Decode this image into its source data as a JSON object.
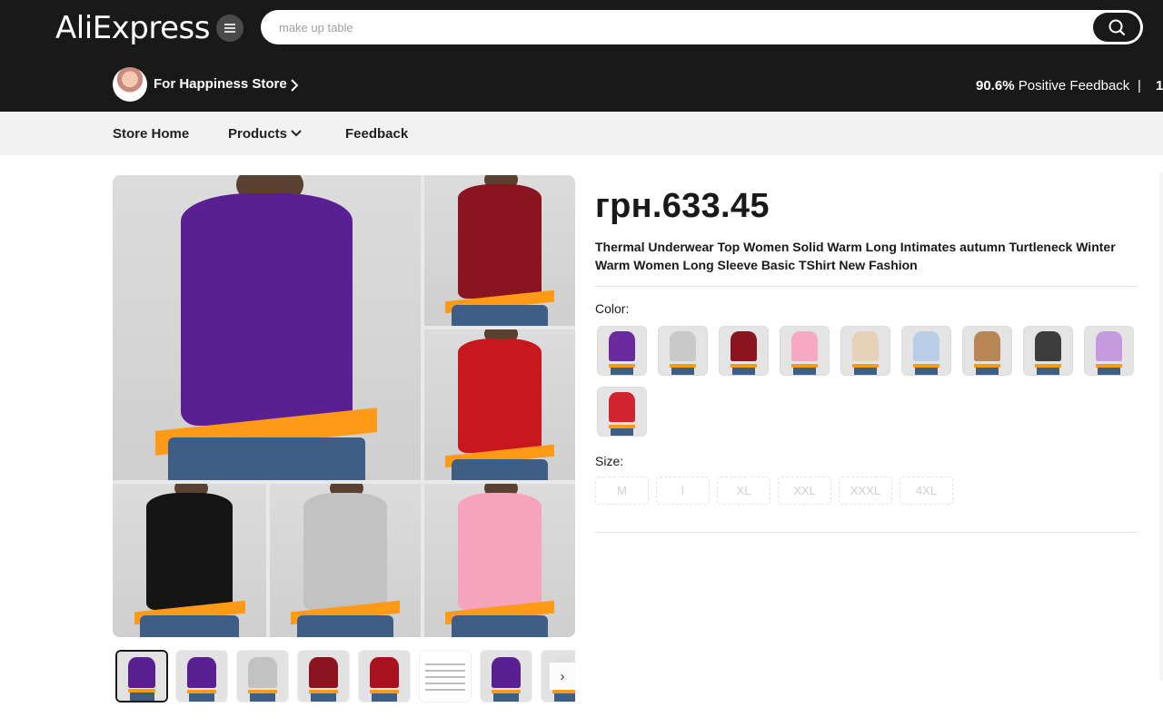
{
  "header": {
    "logo": "AliExpress",
    "search": {
      "value": "",
      "placeholder": "make up table"
    }
  },
  "store": {
    "name": "For Happiness Store",
    "feedback_percent": "90.6%",
    "feedback_label": "Positive Feedback",
    "separator": "|",
    "followers_partial": "1"
  },
  "nav": {
    "items": [
      {
        "label": "Store Home"
      },
      {
        "label": "Products"
      },
      {
        "label": "Feedback"
      }
    ]
  },
  "gallery": {
    "tiles": [
      {
        "color": "#5b1f94"
      },
      {
        "color": "#8a1420"
      },
      {
        "color": "#c8171f"
      },
      {
        "color": "#151515"
      },
      {
        "color": "#c2c2c2"
      },
      {
        "color": "#f6a3bd"
      }
    ],
    "thumbnails": [
      {
        "color": "#5b1f94",
        "active": true
      },
      {
        "color": "#5b1f94"
      },
      {
        "color": "#c2c2c2"
      },
      {
        "color": "#8a1420"
      },
      {
        "color": "#a8121e"
      },
      {
        "color": "size-chart"
      },
      {
        "color": "#5b1f94"
      },
      {
        "color": "#dedede"
      }
    ],
    "next_icon": "›"
  },
  "product": {
    "price": "грн.633.45",
    "title": "Thermal Underwear Top Women Solid Warm Long Intimates autumn Turtleneck Winter Warm Women Long Sleeve Basic TShirt New Fashion",
    "color_label": "Color:",
    "colors": [
      {
        "color": "#6a2aa0"
      },
      {
        "color": "#c9c9c9"
      },
      {
        "color": "#8a1420"
      },
      {
        "color": "#f6a9c2"
      },
      {
        "color": "#e6d2b8"
      },
      {
        "color": "#b9cde6"
      },
      {
        "color": "#b98656"
      },
      {
        "color": "#3d3d3d"
      },
      {
        "color": "#c69adf"
      },
      {
        "color": "#d0242e"
      }
    ],
    "size_label": "Size:",
    "sizes": [
      "M",
      "l",
      "XL",
      "XXL",
      "XXXL",
      "4XL"
    ]
  }
}
